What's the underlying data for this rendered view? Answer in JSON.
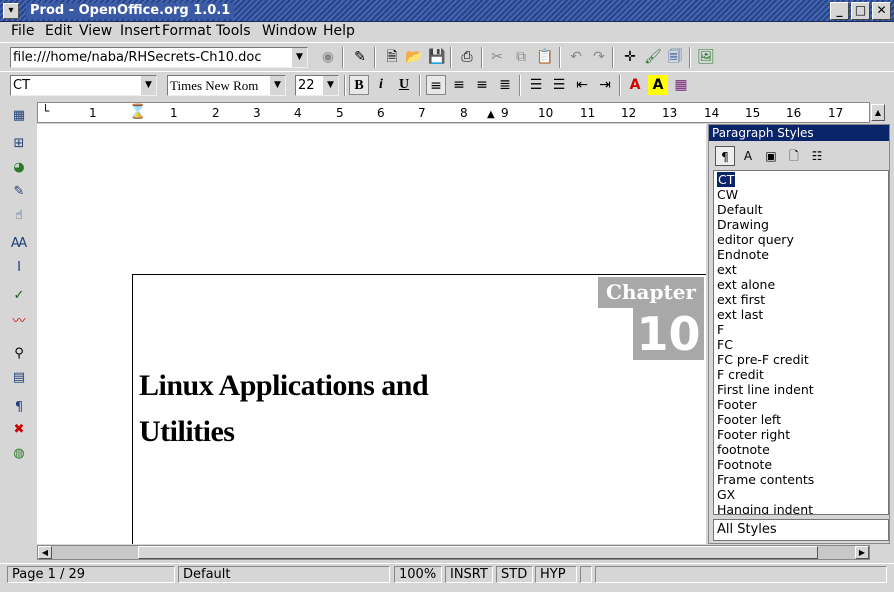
{
  "window": {
    "title": "Prod - OpenOffice.org 1.0.1"
  },
  "menu": [
    "File",
    "Edit",
    "View",
    "Insert",
    "Format",
    "Tools",
    "Window",
    "Help"
  ],
  "toolbar": {
    "url": "file:///home/naba/RHSecrets-Ch10.doc"
  },
  "format": {
    "style": "CT",
    "font": "Times New Rom",
    "size": "22",
    "bold": "B",
    "italic": "i",
    "underline": "U"
  },
  "ruler": [
    "1",
    "1",
    "2",
    "3",
    "4",
    "5",
    "6",
    "7",
    "8",
    "9",
    "10",
    "11",
    "12",
    "13",
    "14",
    "15",
    "16",
    "17"
  ],
  "document": {
    "chapter_label": "Chapter",
    "chapter_number": "10",
    "title_line1": "Linux Applications and",
    "title_line2": "Utilities"
  },
  "styles_panel": {
    "title": "Paragraph Styles",
    "items": [
      "CT",
      "CW",
      "Default",
      "Drawing",
      "editor query",
      "Endnote",
      "ext",
      "ext alone",
      "ext first",
      "ext last",
      "F",
      "FC",
      "FC pre-F credit",
      "F credit",
      "First line indent",
      "Footer",
      "Footer left",
      "Footer right",
      "footnote",
      "Footnote",
      "Frame contents",
      "GX",
      "Hanging indent"
    ],
    "selected": "CT",
    "filter": "All Styles"
  },
  "status": {
    "page": "Page 1 / 29",
    "page_style": "Default",
    "zoom": "100%",
    "insert": "INSRT",
    "selection": "STD",
    "hyperlink": "HYP"
  },
  "colors": {
    "title_bar": "#3a5aa5",
    "panel_header": "#0a246a",
    "chapter_box": "#a8a8a8"
  }
}
